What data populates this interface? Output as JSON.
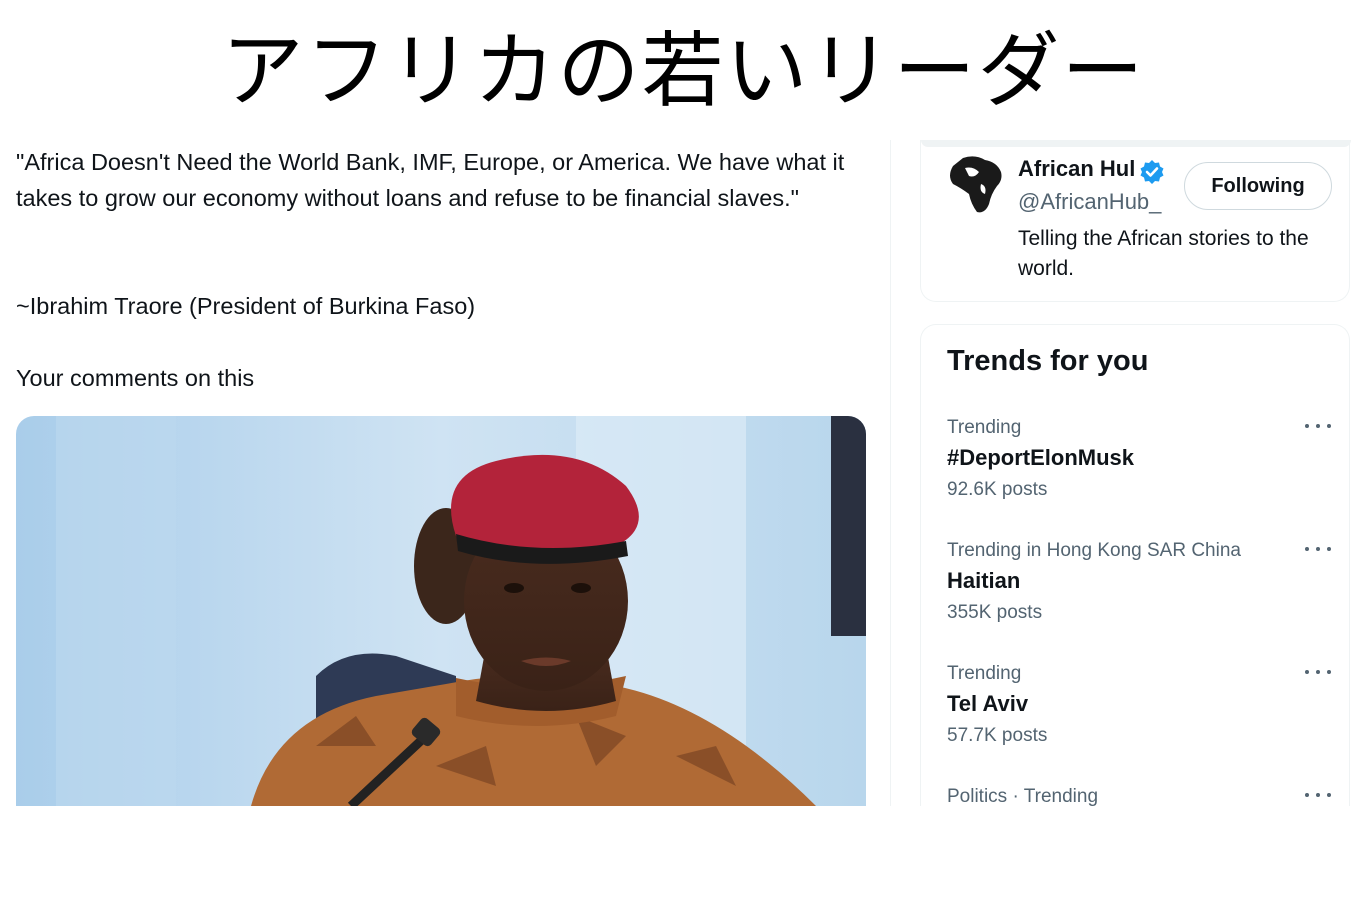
{
  "banner": {
    "title": "アフリカの若いリーダー"
  },
  "tweet": {
    "quote": "\"Africa Doesn't Need the World Bank, IMF, Europe, or America. We have what it takes to grow our economy without loans and refuse to be financial slaves.\"",
    "attribution": "~Ibrahim Traore (President of Burkina Faso)",
    "comment_prompt": "Your comments on this"
  },
  "profile": {
    "display_name": "African Hul",
    "handle": "@AfricanHub_",
    "bio": "Telling the African stories to the world.",
    "follow_label": "Following",
    "verified_color": "#1d9bf0"
  },
  "trends": {
    "title": "Trends for you",
    "items": [
      {
        "context": "Trending",
        "name": "#DeportElonMusk",
        "posts": "92.6K posts"
      },
      {
        "context": "Trending in Hong Kong SAR China",
        "name": "Haitian",
        "posts": "355K posts"
      },
      {
        "context": "Trending",
        "name": "Tel Aviv",
        "posts": "57.7K posts"
      },
      {
        "context": "Politics · Trending",
        "name": "",
        "posts": ""
      }
    ]
  },
  "colors": {
    "text": "#0f1419",
    "secondary": "#536471",
    "border": "#eff3f4",
    "beret": "#b3233a",
    "uniform": "#b06a35"
  }
}
